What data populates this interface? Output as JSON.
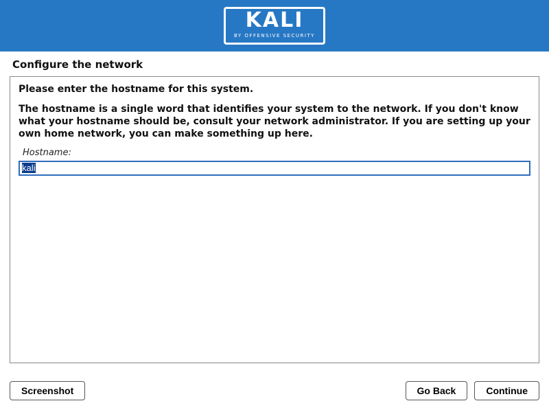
{
  "brand": {
    "name": "KALI",
    "tagline": "BY OFFENSIVE SECURITY"
  },
  "page": {
    "title": "Configure the network",
    "prompt": "Please enter the hostname for this system.",
    "description": "The hostname is a single word that identifies your system to the network. If you don't know what your hostname should be, consult your network administrator. If you are setting up your own home network, you can make something up here.",
    "field_label": "Hostname:",
    "hostname_value": "kali"
  },
  "buttons": {
    "screenshot": "Screenshot",
    "go_back": "Go Back",
    "continue": "Continue"
  },
  "colors": {
    "header_bg": "#2778c4",
    "input_border": "#2e6bbd",
    "selection_bg": "#0a3b8c"
  }
}
